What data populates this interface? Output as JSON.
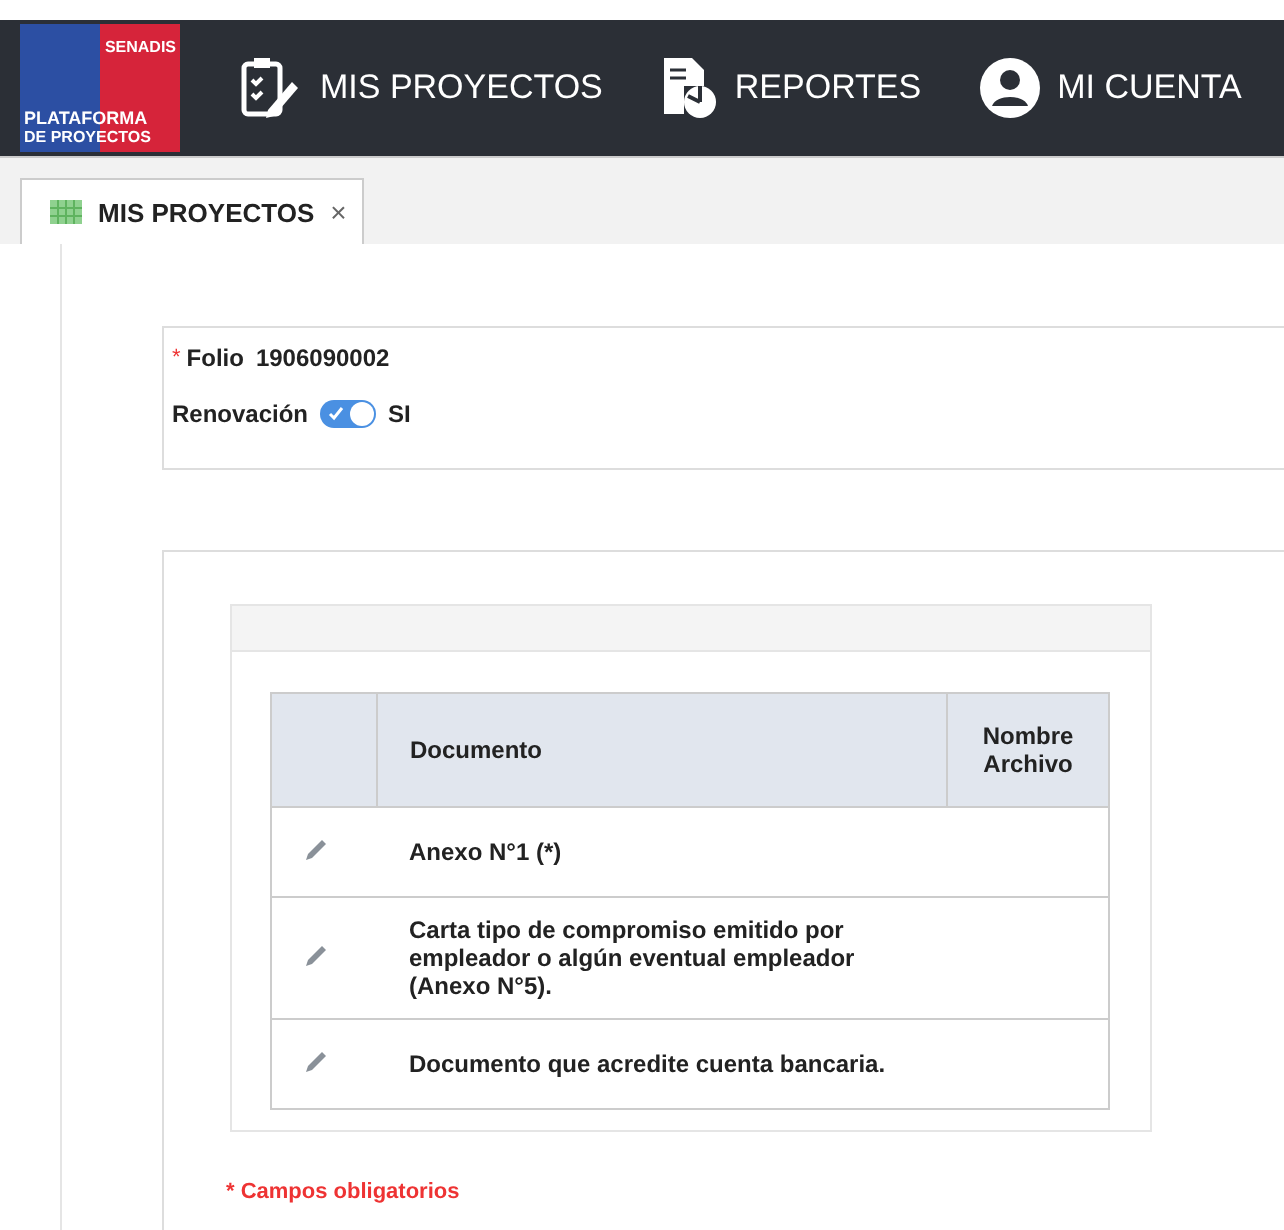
{
  "logo": {
    "top": "SENADIS",
    "line_1": "PLATAFORMA",
    "line_2": "DE PROYECTOS"
  },
  "nav": [
    {
      "label": "MIS PROYECTOS",
      "kind": "projects"
    },
    {
      "label": "REPORTES",
      "kind": "reports"
    },
    {
      "label": "MI CUENTA",
      "kind": "account"
    }
  ],
  "tabs": [
    {
      "label": "MIS PROYECTOS",
      "close": "×",
      "selected": true
    }
  ],
  "folio": {
    "required_mark": "*",
    "label": "Folio",
    "value": "1906090002"
  },
  "renovacion": {
    "label": "Renovación",
    "on": true,
    "value": "SI"
  },
  "table": {
    "columns": [
      "",
      "Documento",
      "Nombre Archivo"
    ],
    "rows": [
      {
        "documento": "Anexo N°1 (*)"
      },
      {
        "documento": "Carta tipo de compromiso emitido por empleador o algún eventual empleador (Anexo N°5)."
      },
      {
        "documento": "Documento que acredite cuenta bancaria."
      }
    ]
  },
  "footnote": "* Campos obligatorios"
}
